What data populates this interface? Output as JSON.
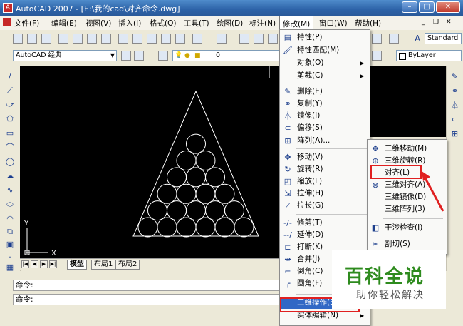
{
  "window": {
    "title": "AutoCAD 2007 - [E:\\我的cad\\对齐命令.dwg]",
    "controls": [
      "–",
      "□",
      "✕"
    ]
  },
  "menubar": [
    "文件(F)",
    "编辑(E)",
    "视图(V)",
    "插入(I)",
    "格式(O)",
    "工具(T)",
    "绘图(D)",
    "标注(N)",
    "修改(M)",
    "窗口(W)",
    "帮助(H)"
  ],
  "toolbar": {
    "workspace": "AutoCAD 经典",
    "layer_value": "0",
    "text_style": "Standard",
    "color_value": "ByLayer"
  },
  "tabs": {
    "model": "模型",
    "layout1": "布局1",
    "layout2": "布局2"
  },
  "command": {
    "line1": "命令:",
    "line2": "命令:"
  },
  "modify_menu": {
    "items": [
      {
        "label": "特性(P)",
        "icon": "properties-icon"
      },
      {
        "label": "特性匹配(M)",
        "icon": "match-properties-icon"
      },
      {
        "label": "对象(O)",
        "icon": "",
        "submenu": true
      },
      {
        "label": "剪裁(C)",
        "icon": "",
        "submenu": true
      },
      {
        "label": "删除(E)",
        "icon": "erase-icon"
      },
      {
        "label": "复制(Y)",
        "icon": "copy-icon"
      },
      {
        "label": "镜像(I)",
        "icon": "mirror-icon"
      },
      {
        "label": "偏移(S)",
        "icon": "offset-icon"
      },
      {
        "label": "阵列(A)...",
        "icon": "array-icon"
      },
      {
        "label": "移动(V)",
        "icon": "move-icon"
      },
      {
        "label": "旋转(R)",
        "icon": "rotate-icon"
      },
      {
        "label": "缩放(L)",
        "icon": "scale-icon"
      },
      {
        "label": "拉伸(H)",
        "icon": "stretch-icon"
      },
      {
        "label": "拉长(G)",
        "icon": "lengthen-icon"
      },
      {
        "label": "修剪(T)",
        "icon": "trim-icon"
      },
      {
        "label": "延伸(D)",
        "icon": "extend-icon"
      },
      {
        "label": "打断(K)",
        "icon": "break-icon"
      },
      {
        "label": "合并(J)",
        "icon": "join-icon"
      },
      {
        "label": "倒角(C)",
        "icon": "chamfer-icon"
      },
      {
        "label": "圆角(F)",
        "icon": "fillet-icon"
      },
      {
        "label": "三维操作(3)",
        "icon": "",
        "submenu": true
      },
      {
        "label": "实体编辑(N)",
        "icon": "",
        "submenu": true
      }
    ]
  },
  "op3d_submenu": {
    "items": [
      {
        "label": "三维移动(M)",
        "icon": "3d-move-icon"
      },
      {
        "label": "三维旋转(R)",
        "icon": "3d-rotate-icon"
      },
      {
        "label": "对齐(L)",
        "icon": ""
      },
      {
        "label": "三维对齐(A)",
        "icon": "3d-align-icon"
      },
      {
        "label": "三维镜像(D)",
        "icon": ""
      },
      {
        "label": "三维阵列(3)",
        "icon": ""
      },
      {
        "label": "干涉检查(I)",
        "icon": "interference-icon"
      },
      {
        "label": "剖切(S)",
        "icon": "slice-icon"
      }
    ]
  },
  "axes": {
    "x": "X",
    "y": "Y"
  },
  "watermark": {
    "title": "百科全说",
    "subtitle": "助你轻松解决"
  },
  "colors": {
    "highlight": "#e02020",
    "watermark_green": "#2e8b1e"
  }
}
